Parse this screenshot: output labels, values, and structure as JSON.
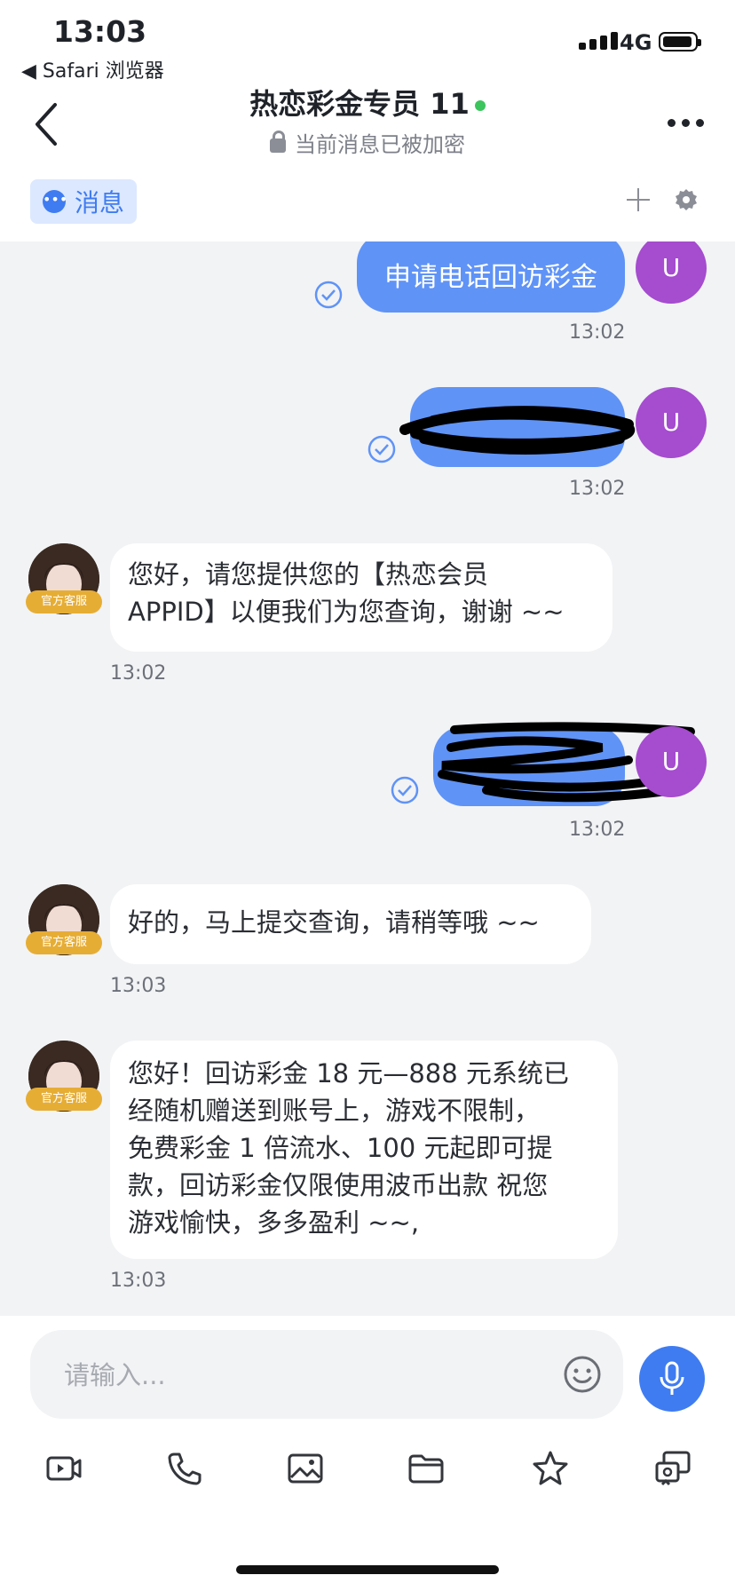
{
  "status_bar": {
    "time": "13:03",
    "back_app": "◀ Safari 浏览器",
    "network": "4G"
  },
  "header": {
    "title": "热恋彩金专员 11",
    "subtitle": "当前消息已被加密"
  },
  "tabs": {
    "message_label": "消息"
  },
  "chat": {
    "user_avatar_letter": "U",
    "agent_badge": "官方客服",
    "messages": [
      {
        "text": "申请电话回访彩金",
        "time": "13:02"
      },
      {
        "text": "",
        "time": "13:02"
      },
      {
        "lines": [
          "您好，请您提供您的【热恋会员",
          "APPID】以便我们为您查询，谢谢 ~~"
        ],
        "time": "13:02"
      },
      {
        "text": "",
        "time": "13:02"
      },
      {
        "text": "好的，马上提交查询，请稍等哦 ~~",
        "time": "13:03"
      },
      {
        "lines": [
          "您好！回访彩金 18 元—888 元系统已",
          "经随机赠送到账号上，游戏不限制，",
          "免费彩金 1 倍流水、100 元起即可提",
          "款，回访彩金仅限使用波币出款 祝您",
          "游戏愉快，多多盈利 ~~,"
        ],
        "time": "13:03"
      }
    ]
  },
  "input": {
    "placeholder": "请输入..."
  },
  "colors": {
    "accent": "#3f7cf1",
    "outgoing_bubble": "#5f93f6",
    "user_avatar": "#a54ccf",
    "badge": "#e6ad35",
    "chat_bg": "#f2f3f5"
  }
}
